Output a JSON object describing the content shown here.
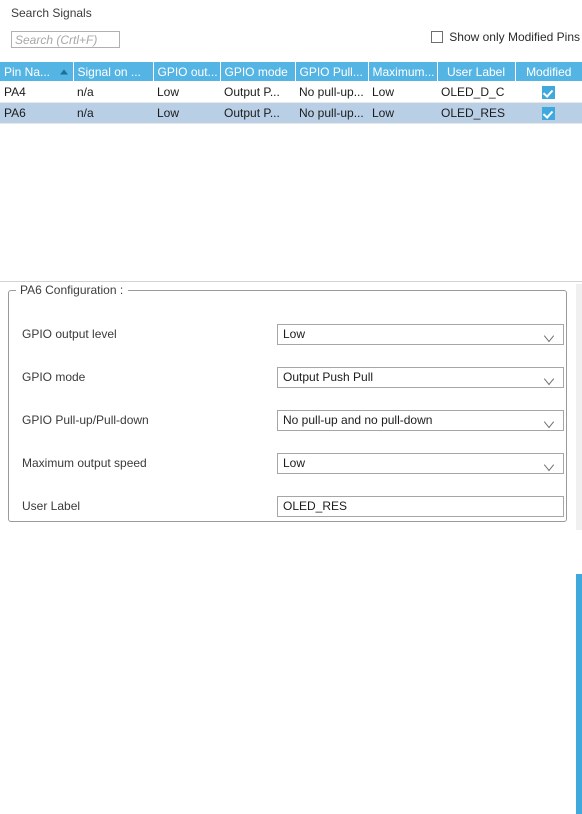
{
  "search": {
    "label": "Search Signals",
    "placeholder": "Search (Crtl+F)",
    "value": ""
  },
  "filter": {
    "modified_only_label": "Show only Modified Pins",
    "modified_only_checked": false
  },
  "table": {
    "columns": [
      "Pin Na...",
      "Signal on ...",
      "GPIO out...",
      "GPIO mode",
      "GPIO Pull...",
      "Maximum...",
      "User Label",
      "Modified"
    ],
    "sort_column": "Pin Na...",
    "sort_direction": "ascending",
    "rows": [
      {
        "pin_name": "PA4",
        "signal_on_pin": "n/a",
        "gpio_output_level": "Low",
        "gpio_mode": "Output P...",
        "gpio_pull": "No pull-up...",
        "maximum_speed": "Low",
        "user_label": "OLED_D_C",
        "modified": true,
        "selected": false
      },
      {
        "pin_name": "PA6",
        "signal_on_pin": "n/a",
        "gpio_output_level": "Low",
        "gpio_mode": "Output P...",
        "gpio_pull": "No pull-up...",
        "maximum_speed": "Low",
        "user_label": "OLED_RES",
        "modified": true,
        "selected": true
      }
    ]
  },
  "config": {
    "legend": "PA6 Configuration :",
    "fields": [
      {
        "label": "GPIO output level",
        "value": "Low",
        "type": "dropdown"
      },
      {
        "label": "GPIO mode",
        "value": "Output Push Pull",
        "type": "dropdown"
      },
      {
        "label": "GPIO Pull-up/Pull-down",
        "value": "No pull-up and no pull-down",
        "type": "dropdown"
      },
      {
        "label": "Maximum output speed",
        "value": "Low",
        "type": "dropdown"
      },
      {
        "label": "User Label",
        "value": "OLED_RES",
        "type": "text"
      }
    ]
  },
  "colors": {
    "header_blue": "#54b5e5",
    "selected_row": "#b8cfe5",
    "accent": "#3fa9dd"
  }
}
